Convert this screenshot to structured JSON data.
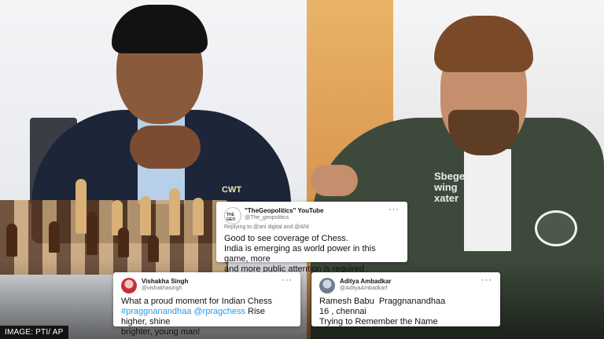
{
  "photo": {
    "left_caption": "CWT",
    "sponsor_text": "Sbeger\nwing\nxater"
  },
  "tweets": [
    {
      "name": "\"TheGeopolitics\" YouTube",
      "handle": "@The_geopolitics",
      "reply_line": "Replying to @ani digital and @ANI",
      "avatar_text": "THE GEO",
      "lines": [
        "Good to see coverage of Chess.",
        "India is emerging as world power in this game, more",
        "and more public attention is required ."
      ]
    },
    {
      "name": "Vishakha Singh",
      "handle": "@vishakhasingh",
      "line1": "What a proud moment for Indian Chess",
      "tag1": "#praggnanandhaa",
      "tag2": "@rpragchess",
      "line2_rest": " Rise higher, shine",
      "line3": "brighter, young man!"
    },
    {
      "name": "Aditya Ambadkar",
      "handle": "@AdityaAmbadkarf",
      "lines": [
        "Ramesh Babu  Praggnanandhaa",
        "16 , chennai",
        "Trying to Remember the Name"
      ]
    }
  ],
  "credit": "IMAGE: PTI/ AP",
  "icons": {
    "more": "more-horizontal-icon"
  }
}
